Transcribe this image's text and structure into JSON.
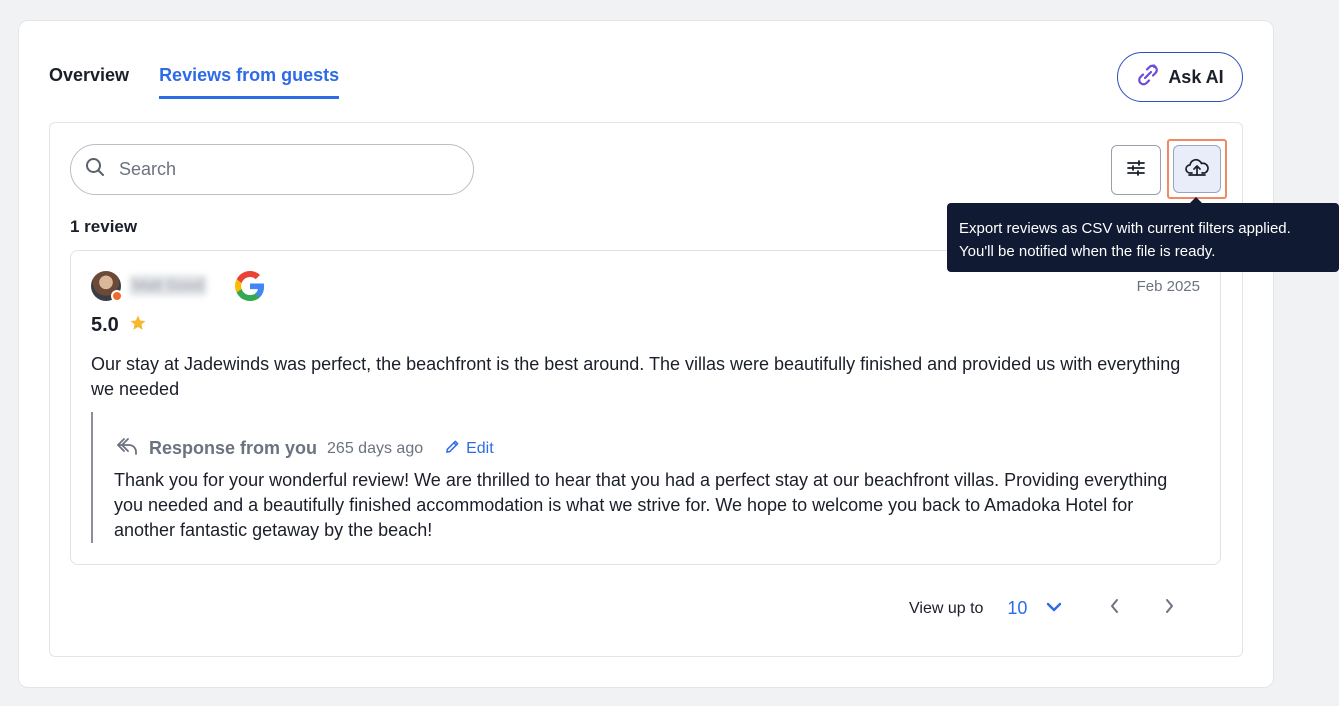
{
  "tabs": [
    {
      "label": "Overview",
      "active": false
    },
    {
      "label": "Reviews from guests",
      "active": true
    }
  ],
  "ask_ai": {
    "label": "Ask AI",
    "icon": "ai-link-icon"
  },
  "search": {
    "placeholder": "Search",
    "value": ""
  },
  "toolbar": {
    "filter_icon": "sliders-icon",
    "export_icon": "cloud-upload-icon"
  },
  "review_count": "1 review",
  "review": {
    "reviewer_name": "Matt Good",
    "source_icon": "google-icon",
    "date": "Feb 2025",
    "rating": "5.0",
    "text": "Our stay at Jadewinds was perfect, the beachfront is the best around. The villas were beautifully finished and provided us with everything we needed",
    "response": {
      "label": "Response from you",
      "time": "265 days ago",
      "edit_label": "Edit",
      "text": "Thank you for your wonderful review! We are thrilled to hear that you had a perfect stay at our beachfront villas. Providing everything you needed and a beautifully finished accommodation is what we strive for. We hope to welcome you back to Amadoka Hotel for another fantastic getaway by the beach!"
    }
  },
  "pagination": {
    "label": "View up to",
    "value": "10"
  },
  "tooltip": {
    "line1": "Export reviews as CSV with current filters applied.",
    "line2": "You'll be notified when the file is ready."
  },
  "colors": {
    "accent": "#2e6be6",
    "tooltip_bg": "#111a33",
    "highlight": "#ef8a63",
    "star": "#f5b82e"
  }
}
